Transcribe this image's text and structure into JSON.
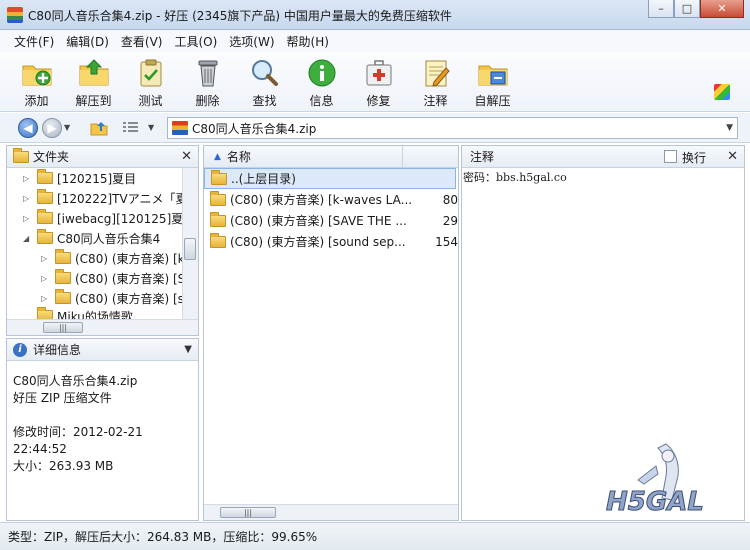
{
  "window": {
    "title": "C80同人音乐合集4.zip - 好压 (2345旗下产品) 中国用户量最大的免费压缩软件",
    "minimize_glyph": "–",
    "maximize_glyph": "□",
    "close_glyph": "✕"
  },
  "menu": [
    "文件(F)",
    "编辑(D)",
    "查看(V)",
    "工具(O)",
    "选项(W)",
    "帮助(H)"
  ],
  "toolbar": {
    "buttons": [
      {
        "label": "添加",
        "icon": "folder-add-icon"
      },
      {
        "label": "解压到",
        "icon": "folder-extract-icon"
      },
      {
        "label": "测试",
        "icon": "clipboard-check-icon"
      },
      {
        "label": "删除",
        "icon": "trash-icon"
      },
      {
        "label": "查找",
        "icon": "magnifier-icon"
      },
      {
        "label": "信息",
        "icon": "info-icon"
      },
      {
        "label": "修复",
        "icon": "first-aid-kit-icon"
      },
      {
        "label": "注释",
        "icon": "notepad-icon"
      },
      {
        "label": "自解压",
        "icon": "self-extract-icon"
      }
    ]
  },
  "address": {
    "path": "C80同人音乐合集4.zip"
  },
  "folder_pane": {
    "title": "文件夹",
    "items": [
      {
        "label": "[120215]夏目",
        "level": 1,
        "expander": "▷"
      },
      {
        "label": "[120222]TVアニメ「夏",
        "level": 1,
        "expander": "▷"
      },
      {
        "label": "[iwebacg][120125]夏目",
        "level": 1,
        "expander": "▷"
      },
      {
        "label": "C80同人音乐合集4",
        "level": 1,
        "expander": "◢"
      },
      {
        "label": "(C80) (東方音楽) [k",
        "level": 2,
        "expander": "▷"
      },
      {
        "label": "(C80) (東方音楽) [S",
        "level": 2,
        "expander": "▷"
      },
      {
        "label": "(C80) (東方音楽) [s",
        "level": 2,
        "expander": "▷"
      },
      {
        "label": "Miku的场情歌",
        "level": 1,
        "expander": ""
      }
    ]
  },
  "file_list": {
    "column_name": "名称",
    "rows": [
      {
        "name": "..(上层目录)",
        "size": ""
      },
      {
        "name": "(C80) (東方音楽) [k-waves LA...",
        "size": "80"
      },
      {
        "name": "(C80) (東方音楽) [SAVE THE ...",
        "size": "29"
      },
      {
        "name": "(C80) (東方音楽) [sound sep...",
        "size": "154"
      }
    ]
  },
  "comment_pane": {
    "title": "注释",
    "wrap_label": "换行",
    "text": "密码：bbs.h5gal.co"
  },
  "details_pane": {
    "title": "详细信息",
    "filename": "C80同人音乐合集4.zip",
    "filetype": "好压 ZIP 压缩文件",
    "modified": "修改时间：2012-02-21 22:44:52",
    "size": "大小：263.93 MB"
  },
  "status": {
    "text": "类型：ZIP，解压后大小：264.83 MB，压缩比：99.65%"
  },
  "watermark": {
    "text": "H5GAL"
  }
}
